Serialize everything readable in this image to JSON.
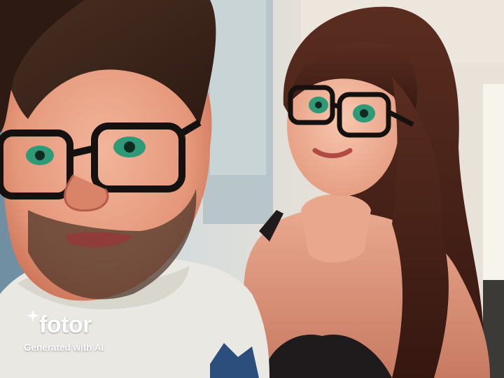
{
  "image": {
    "subject": "stylized 3D cartoon portrait",
    "colors": {
      "wall": "#c9d3d4",
      "man_skin": "#e59a7a",
      "man_hair": "#3b2418",
      "man_shirt": "#e9e8e2",
      "woman_skin": "#f0b396",
      "woman_hair": "#4a2418",
      "eyes": "#2f9a78",
      "glasses": "#15110f"
    }
  },
  "watermark": {
    "brand": "fotor",
    "tagline": "Generated with AI",
    "icon": "sparkle-icon"
  }
}
